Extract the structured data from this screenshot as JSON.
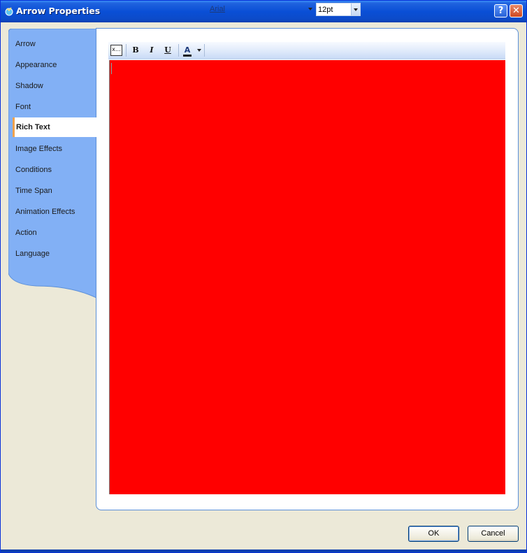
{
  "window": {
    "title": "Arrow Properties",
    "help_label": "?",
    "close_label": "✕"
  },
  "nav": {
    "items": [
      {
        "label": "Arrow"
      },
      {
        "label": "Appearance"
      },
      {
        "label": "Shadow"
      },
      {
        "label": "Font"
      },
      {
        "label": "Rich Text",
        "active": true
      },
      {
        "label": "Image Effects"
      },
      {
        "label": "Conditions"
      },
      {
        "label": "Time Span"
      },
      {
        "label": "Animation Effects"
      },
      {
        "label": "Action"
      },
      {
        "label": "Language"
      }
    ]
  },
  "toolbar": {
    "clear_format_label": "x…",
    "bold_label": "B",
    "italic_label": "I",
    "underline_label": "U",
    "font_color_label": "A",
    "font_name": "Arial",
    "font_size": "12pt"
  },
  "editor": {
    "background_color": "#ff0000",
    "text": ""
  },
  "buttons": {
    "ok_label": "OK",
    "cancel_label": "Cancel"
  },
  "colors": {
    "titlebar": "#0a4fd6",
    "nav_panel": "#82b0f5",
    "active_tab_accent": "#f1a24c"
  },
  "icons": {
    "app": "app-icon",
    "help": "help-icon",
    "close": "close-icon",
    "font_dropdown": "chevron-down-icon",
    "size_dropdown": "chevron-down-icon",
    "color_dropdown": "chevron-down-icon"
  }
}
